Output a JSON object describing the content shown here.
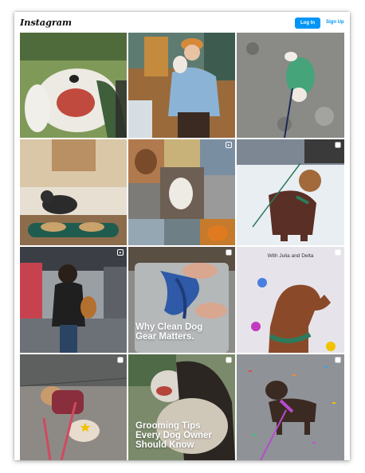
{
  "header": {
    "logo_text": "Instagram",
    "login_label": "Log In",
    "signup_label": "Sign Up"
  },
  "tiles": [
    {
      "subject": "white dog open mouth on grass",
      "overlay": ""
    },
    {
      "subject": "woman with hat holding small dog at cafe",
      "overlay": ""
    },
    {
      "subject": "small dog in green sweater lying on gravel",
      "overlay": ""
    },
    {
      "subject": "dog lying by water and food bowls",
      "overlay": ""
    },
    {
      "subject": "collage of dogs",
      "overlay": ""
    },
    {
      "subject": "poodle in brown coat in snow",
      "overlay": ""
    },
    {
      "subject": "woman with dog on rainy street",
      "overlay": ""
    },
    {
      "subject": "washing blue dog gear in sink",
      "overlay_lines": [
        "Why Clean Dog",
        "Gear Matters."
      ]
    },
    {
      "subject": "brown dog with green harness",
      "caption": "With Julia and Delta"
    },
    {
      "subject": "dogs on wet pavement",
      "overlay": ""
    },
    {
      "subject": "grooming dog",
      "overlay_lines": [
        "Grooming Tips",
        "Every Dog Owner",
        "Should Know"
      ]
    },
    {
      "subject": "dog with purple harness and confetti",
      "overlay": ""
    }
  ],
  "colors": {
    "accent": "#0095f6",
    "overlay_text": "#ffffff"
  },
  "icons": {
    "carousel_badge": "multiple-posts-icon",
    "video_badge": "reel-icon"
  }
}
